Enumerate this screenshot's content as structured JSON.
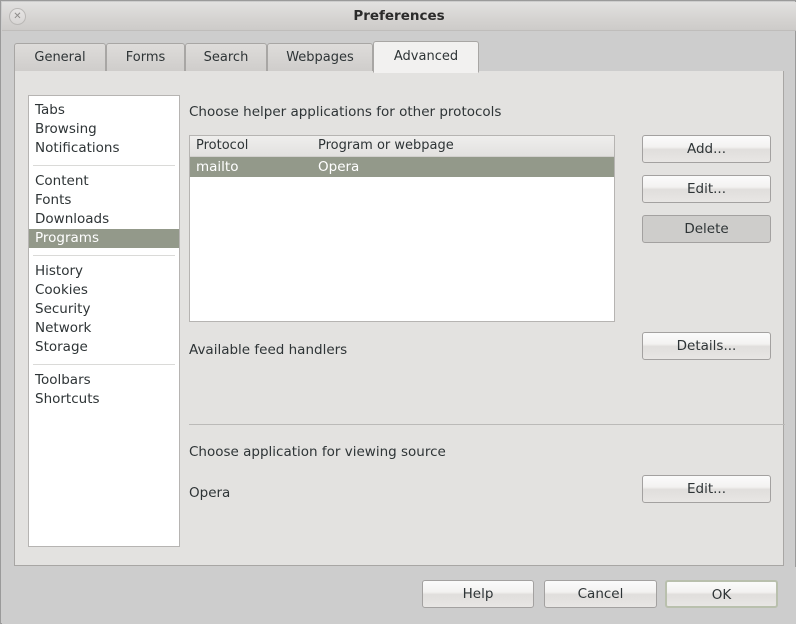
{
  "window": {
    "title": "Preferences",
    "close_icon": "close-icon",
    "close_glyph": "✕"
  },
  "tabs": [
    {
      "label": "General",
      "active": false
    },
    {
      "label": "Forms",
      "active": false
    },
    {
      "label": "Search",
      "active": false
    },
    {
      "label": "Webpages",
      "active": false
    },
    {
      "label": "Advanced",
      "active": true
    }
  ],
  "sidebar": {
    "groups": [
      {
        "items": [
          {
            "label": "Tabs",
            "selected": false
          },
          {
            "label": "Browsing",
            "selected": false
          },
          {
            "label": "Notifications",
            "selected": false
          }
        ]
      },
      {
        "items": [
          {
            "label": "Content",
            "selected": false
          },
          {
            "label": "Fonts",
            "selected": false
          },
          {
            "label": "Downloads",
            "selected": false
          },
          {
            "label": "Programs",
            "selected": true
          }
        ]
      },
      {
        "items": [
          {
            "label": "History",
            "selected": false
          },
          {
            "label": "Cookies",
            "selected": false
          },
          {
            "label": "Security",
            "selected": false
          },
          {
            "label": "Network",
            "selected": false
          },
          {
            "label": "Storage",
            "selected": false
          }
        ]
      },
      {
        "items": [
          {
            "label": "Toolbars",
            "selected": false
          },
          {
            "label": "Shortcuts",
            "selected": false
          }
        ]
      }
    ]
  },
  "main": {
    "protocols_heading": "Choose helper applications for other protocols",
    "protocol_table": {
      "columns": [
        "Protocol",
        "Program or webpage"
      ],
      "rows": [
        {
          "protocol": "mailto",
          "program": "Opera",
          "selected": true
        }
      ]
    },
    "protocol_buttons": [
      {
        "label": "Add...",
        "state": "normal"
      },
      {
        "label": "Edit...",
        "state": "normal"
      },
      {
        "label": "Delete",
        "state": "flat"
      }
    ],
    "feed_handlers_label": "Available feed handlers",
    "feed_details_button": "Details...",
    "viewing_source_heading": "Choose application for viewing source",
    "viewing_source_value": "Opera",
    "viewing_source_edit_button": "Edit..."
  },
  "footer": {
    "help_button": "Help",
    "cancel_button": "Cancel",
    "ok_button": "OK"
  },
  "colors": {
    "selection": "#93998a",
    "window_bg": "#cdcdcd",
    "panel_bg": "#e3e2e0",
    "default_focus": "#b9c0ad"
  }
}
